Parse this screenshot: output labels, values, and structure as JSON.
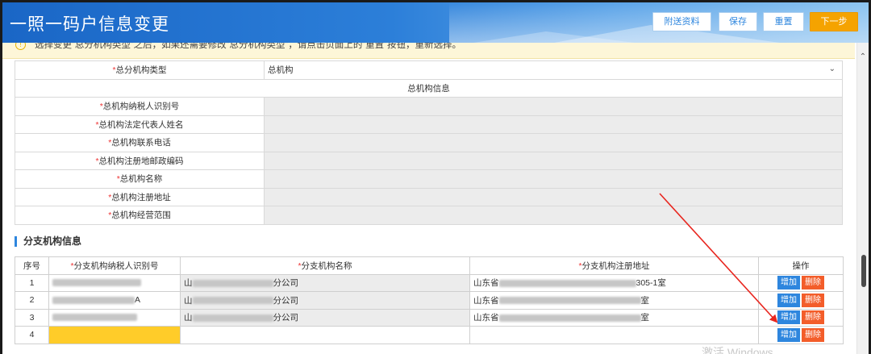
{
  "header": {
    "title": "一照一码户信息变更",
    "buttons": {
      "attach": "附送资料",
      "save": "保存",
      "reset": "重置",
      "next": "下一步"
    }
  },
  "notice": {
    "text": "选择变更“总分机构类型”之后，如果还需要修改“总分机构类型”，请点击页面上的“重置”按钮，重新选择。"
  },
  "form": {
    "type_row": {
      "label": "总分机构类型",
      "value": "总机构"
    },
    "section_header": "总机构信息",
    "fields": [
      {
        "label": "总机构纳税人识别号",
        "value": ""
      },
      {
        "label": "总机构法定代表人姓名",
        "value": ""
      },
      {
        "label": "总机构联系电话",
        "value": ""
      },
      {
        "label": "总机构注册地邮政编码",
        "value": ""
      },
      {
        "label": "总机构名称",
        "value": ""
      },
      {
        "label": "总机构注册地址",
        "value": ""
      },
      {
        "label": "总机构经营范围",
        "value": ""
      }
    ]
  },
  "branch": {
    "title": "分支机构信息",
    "columns": {
      "index": "序号",
      "tax_id": "分支机构纳税人识别号",
      "name": "分支机构名称",
      "address": "分支机构注册地址",
      "ops": "操作"
    },
    "rows": [
      {
        "index": "1",
        "tax_id_suffix": "",
        "name_prefix": "山",
        "name_suffix": "分公司",
        "addr_prefix": "山东省",
        "addr_suffix": "305-1室"
      },
      {
        "index": "2",
        "tax_id_suffix": "A",
        "name_prefix": "山",
        "name_suffix": "分公司",
        "addr_prefix": "山东省",
        "addr_suffix": "室"
      },
      {
        "index": "3",
        "tax_id_suffix": "",
        "name_prefix": "山",
        "name_suffix": "分公司",
        "addr_prefix": "山东省",
        "addr_suffix": "室"
      },
      {
        "index": "4",
        "tax_id_suffix": "",
        "name_prefix": "",
        "name_suffix": "",
        "addr_prefix": "",
        "addr_suffix": ""
      }
    ],
    "ops": {
      "add": "增加",
      "delete": "删除"
    }
  },
  "watermark": "激活 Windows",
  "colors": {
    "primary": "#2e86de",
    "orange": "#f5a300",
    "delete": "#f35d2a",
    "highlight": "#ffcc29",
    "arrow": "#e8261f"
  }
}
